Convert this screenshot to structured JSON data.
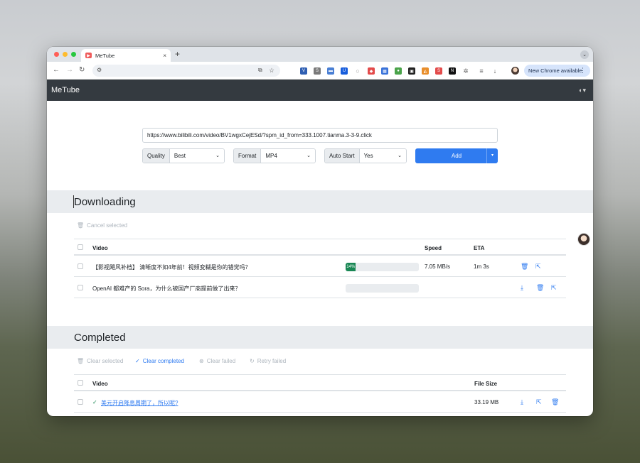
{
  "browser": {
    "tab_title": "MeTube",
    "tab_favicon": "metube-favicon",
    "tab_close": "×",
    "new_tab": "+",
    "tab_menu": "⌄",
    "nav": {
      "back": "←",
      "forward": "→",
      "reload": "↻"
    },
    "site_info": "⚙",
    "install": "⧉",
    "bookmark": "☆",
    "new_chrome_label": "New Chrome available",
    "menu_dots": "⋮",
    "extensions": [
      {
        "name": "vimium-icon",
        "glyph": "V",
        "color": "#2f5fb3"
      },
      {
        "name": "s-icon",
        "glyph": "S",
        "color": "#7a7a7a"
      },
      {
        "name": "bar-icon",
        "glyph": "▬",
        "color": "#4a7fd4"
      },
      {
        "name": "bitwarden-icon",
        "glyph": "U",
        "color": "#175ddc"
      },
      {
        "name": "circle-icon",
        "glyph": "○",
        "color": "#999999"
      },
      {
        "name": "shield-icon",
        "glyph": "◆",
        "color": "#e34b4b"
      },
      {
        "name": "calendar-icon",
        "glyph": "▦",
        "color": "#3a73d9"
      },
      {
        "name": "chrome-icon",
        "glyph": "●",
        "color": "#4aa34a"
      },
      {
        "name": "frame-icon",
        "glyph": "▣",
        "color": "#222222"
      },
      {
        "name": "metamask-icon",
        "glyph": "◭",
        "color": "#e88e2c"
      },
      {
        "name": "red-s-icon",
        "glyph": "S",
        "color": "#e34b4b"
      },
      {
        "name": "notion-icon",
        "glyph": "N",
        "color": "#111111"
      },
      {
        "name": "puzzle-icon",
        "glyph": "✲",
        "color": "#666666"
      },
      {
        "name": "queue-icon",
        "glyph": "≡",
        "color": "#555555"
      },
      {
        "name": "download-icon",
        "glyph": "↓",
        "color": "#555555"
      }
    ]
  },
  "app": {
    "brand": "MeTube",
    "theme_icon": "◐▾"
  },
  "form": {
    "url_value": "https://www.bilibili.com/video/BV1wgxCejESd/?spm_id_from=333.1007.tianma.3-3-9.click",
    "quality_label": "Quality",
    "quality_value": "Best",
    "format_label": "Format",
    "format_value": "MP4",
    "autostart_label": "Auto Start",
    "autostart_value": "Yes",
    "add_label": "Add",
    "caret": "⌄",
    "split_caret": "▾"
  },
  "downloading": {
    "title": "Downloading",
    "cancel_label": "Cancel selected",
    "headers": {
      "video": "Video",
      "speed": "Speed",
      "eta": "ETA"
    },
    "rows": [
      {
        "title": "【影视飓风补档】 清晰度不如4年前！视频变糊是你的错觉吗？",
        "progress_pct": 14,
        "progress_label": "14%",
        "speed": "7.05 MB/s",
        "eta": "1m 3s"
      },
      {
        "title": "OpenAI 都难产的 Sora，为什么被国产厂商提前做了出来？",
        "progress_pct": 0,
        "progress_label": "",
        "speed": "",
        "eta": ""
      }
    ]
  },
  "completed": {
    "title": "Completed",
    "clear_selected": "Clear selected",
    "clear_completed": "Clear completed",
    "clear_failed": "Clear failed",
    "retry_failed": "Retry failed",
    "headers": {
      "video": "Video",
      "file_size": "File Size"
    },
    "rows": [
      {
        "title": "美元开启降息周期了，所以呢?",
        "file_size": "33.19 MB"
      }
    ]
  },
  "icons": {
    "trash": "🗑",
    "open": "⇱",
    "download": "⤓",
    "check_circle": "✓",
    "x_circle": "⊗",
    "retry": "↻"
  }
}
